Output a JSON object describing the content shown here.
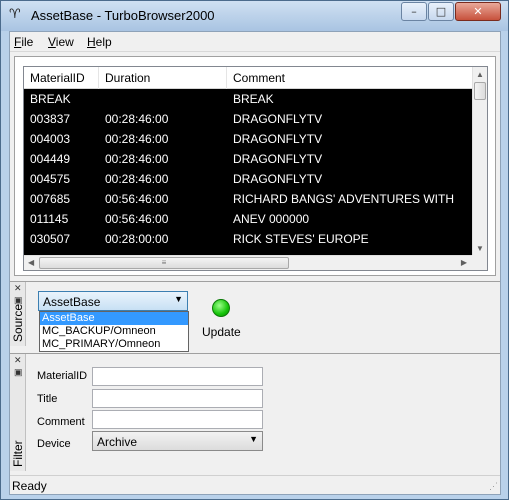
{
  "window": {
    "title": "AssetBase - TurboBrowser2000",
    "icon": "app-glyph-icon",
    "controls": [
      "minimize-icon",
      "maximize-icon",
      "close-icon"
    ]
  },
  "menu": {
    "items": [
      {
        "label": "File"
      },
      {
        "label": "View"
      },
      {
        "label": "Help"
      }
    ]
  },
  "grid": {
    "columns": [
      {
        "label": "MaterialID"
      },
      {
        "label": "Duration"
      },
      {
        "label": "Comment"
      }
    ],
    "rows": [
      {
        "id": "BREAK",
        "duration": "",
        "comment": "BREAK"
      },
      {
        "id": "003837",
        "duration": "00:28:46:00",
        "comment": "DRAGONFLYTV"
      },
      {
        "id": "004003",
        "duration": "00:28:46:00",
        "comment": "DRAGONFLYTV"
      },
      {
        "id": "004449",
        "duration": "00:28:46:00",
        "comment": "DRAGONFLYTV"
      },
      {
        "id": "004575",
        "duration": "00:28:46:00",
        "comment": "DRAGONFLYTV"
      },
      {
        "id": "007685",
        "duration": "00:56:46:00",
        "comment": "RICHARD BANGS' ADVENTURES WITH"
      },
      {
        "id": "011145",
        "duration": "00:56:46:00",
        "comment": "ANEV  000000"
      },
      {
        "id": "030507",
        "duration": "00:28:00:00",
        "comment": "RICK STEVES' EUROPE"
      }
    ]
  },
  "source": {
    "tab_label": "Source",
    "selected": "AssetBase",
    "options": [
      "AssetBase",
      "MC_BACKUP/Omneon",
      "MC_PRIMARY/Omneon"
    ],
    "update_label": "Update",
    "status_color": "#16c40a"
  },
  "filter": {
    "tab_label": "Filter",
    "fields": {
      "material_id": {
        "label": "MaterialID",
        "value": ""
      },
      "title": {
        "label": "Title",
        "value": ""
      },
      "comment": {
        "label": "Comment",
        "value": ""
      },
      "device": {
        "label": "Device",
        "value": "Archive"
      }
    }
  },
  "status": {
    "text": "Ready"
  }
}
